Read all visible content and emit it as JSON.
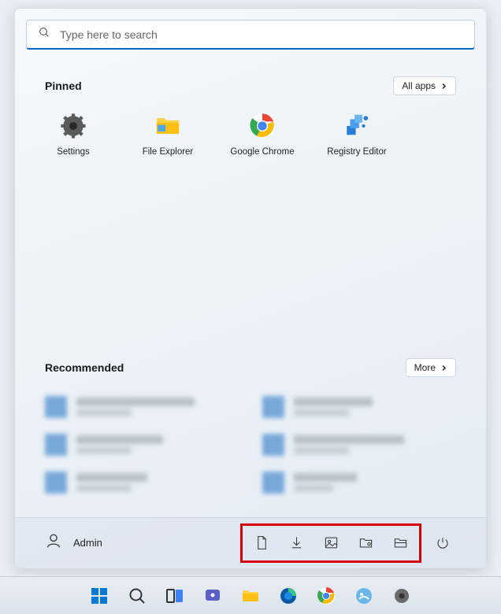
{
  "search": {
    "placeholder": "Type here to search"
  },
  "pinned": {
    "title": "Pinned",
    "all_apps_label": "All apps",
    "items": [
      {
        "label": "Settings"
      },
      {
        "label": "File Explorer"
      },
      {
        "label": "Google Chrome"
      },
      {
        "label": "Registry Editor"
      }
    ]
  },
  "recommended": {
    "title": "Recommended",
    "more_label": "More"
  },
  "footer": {
    "user_name": "Admin",
    "folder_icons": [
      "documents",
      "downloads",
      "pictures",
      "videos",
      "file-explorer"
    ]
  },
  "taskbar": {
    "items": [
      "start",
      "search",
      "task-view",
      "chat",
      "file-explorer",
      "edge",
      "chrome",
      "snipping-tool",
      "settings"
    ]
  }
}
